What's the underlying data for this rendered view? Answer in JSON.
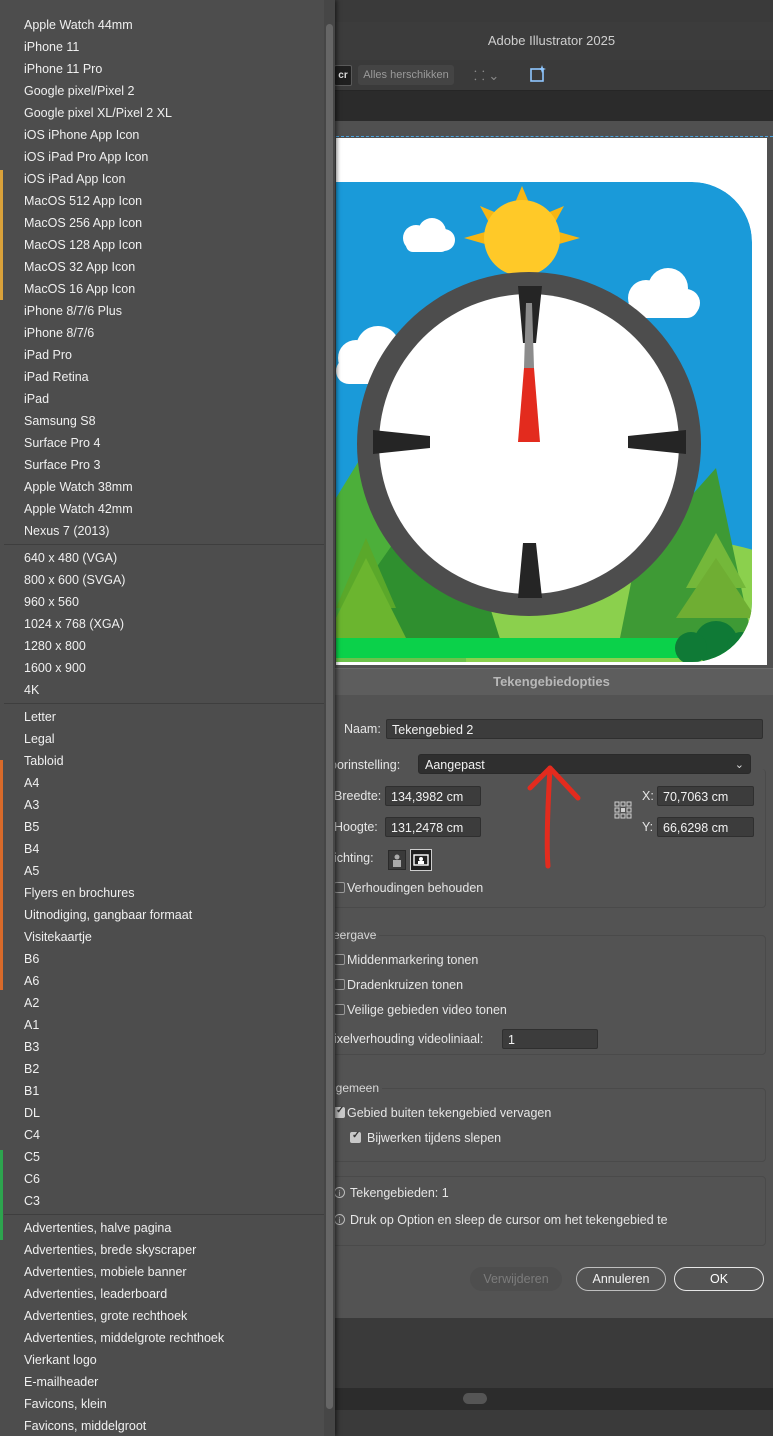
{
  "app": {
    "title": "Adobe Illustrator 2025"
  },
  "toolbar": {
    "cr_label": "cr",
    "arrange_label": "Alles herschikken"
  },
  "dialog": {
    "title": "Tekengebiedopties",
    "name_label": "Naam:",
    "name_value": "Tekengebied 2",
    "preset_label": "oorinstelling:",
    "preset_value": "Aangepast",
    "width_label": "Breedte:",
    "width_value": "134,3982 cm",
    "height_label": "Hoogte:",
    "height_value": "131,2478 cm",
    "x_label": "X:",
    "x_value": "70,7063 cm",
    "y_label": "Y:",
    "y_value": "66,6298 cm",
    "orientation_label": "ichting:",
    "keep_ratio_label": "Verhoudingen behouden",
    "display_title": "eergave",
    "show_center_label": "Middenmarkering tonen",
    "show_crosshairs_label": "Dradenkruizen tonen",
    "show_video_safe_label": "Veilige gebieden video tonen",
    "pixel_ratio_label": "ixelverhouding videoliniaal:",
    "pixel_ratio_value": "1",
    "general_title": "lgemeen",
    "fade_outside_label": "Gebied buiten tekengebied vervagen",
    "update_drag_label": "Bijwerken tijdens slepen",
    "artboards_info": "Tekengebieden: 1",
    "hint_info": "Druk op Option en sleep de cursor om het tekengebied te",
    "delete_label": "Verwijderen",
    "cancel_label": "Annuleren",
    "ok_label": "OK"
  },
  "preset_groups": [
    [
      "Apple Watch 44mm",
      "iPhone 11",
      "iPhone 11 Pro",
      "Google pixel/Pixel 2",
      "Google pixel XL/Pixel 2 XL",
      "iOS iPhone App Icon",
      "iOS iPad Pro App Icon",
      "iOS iPad App Icon",
      "MacOS 512 App Icon",
      "MacOS 256 App Icon",
      "MacOS 128 App Icon",
      "MacOS 32 App Icon",
      "MacOS 16 App Icon",
      "iPhone 8/7/6 Plus",
      "iPhone 8/7/6",
      "iPad Pro",
      "iPad Retina",
      "iPad",
      "Samsung S8",
      "Surface Pro 4",
      "Surface Pro 3",
      "Apple Watch 38mm",
      "Apple Watch 42mm",
      "Nexus 7 (2013)"
    ],
    [
      "640 x 480 (VGA)",
      "800 x 600 (SVGA)",
      "960 x 560",
      "1024 x 768 (XGA)",
      "1280 x 800",
      "1600 x 900",
      "4K"
    ],
    [
      "Letter",
      "Legal",
      "Tabloid",
      "A4",
      "A3",
      "B5",
      "B4",
      "A5",
      "Flyers en brochures",
      "Uitnodiging, gangbaar formaat",
      "Visitekaartje",
      "B6",
      "A6",
      "A2",
      "A1",
      "B3",
      "B2",
      "B1",
      "DL",
      "C4",
      "C5",
      "C6",
      "C3"
    ],
    [
      "Advertenties, halve pagina",
      "Advertenties, brede skyscraper",
      "Advertenties, mobiele banner",
      "Advertenties, leaderboard",
      "Advertenties, grote rechthoek",
      "Advertenties, middelgrote rechthoek",
      "Vierkant logo",
      "E-mailheader",
      "Favicons, klein",
      "Favicons, middelgroot"
    ]
  ],
  "icons": {
    "info": "info-icon",
    "reference_point": "reference-point-icon",
    "chevron": "chevron-down-icon"
  },
  "colors": {
    "accent_blue": "#1a9ad9",
    "annotation_red": "#e32b1e"
  }
}
